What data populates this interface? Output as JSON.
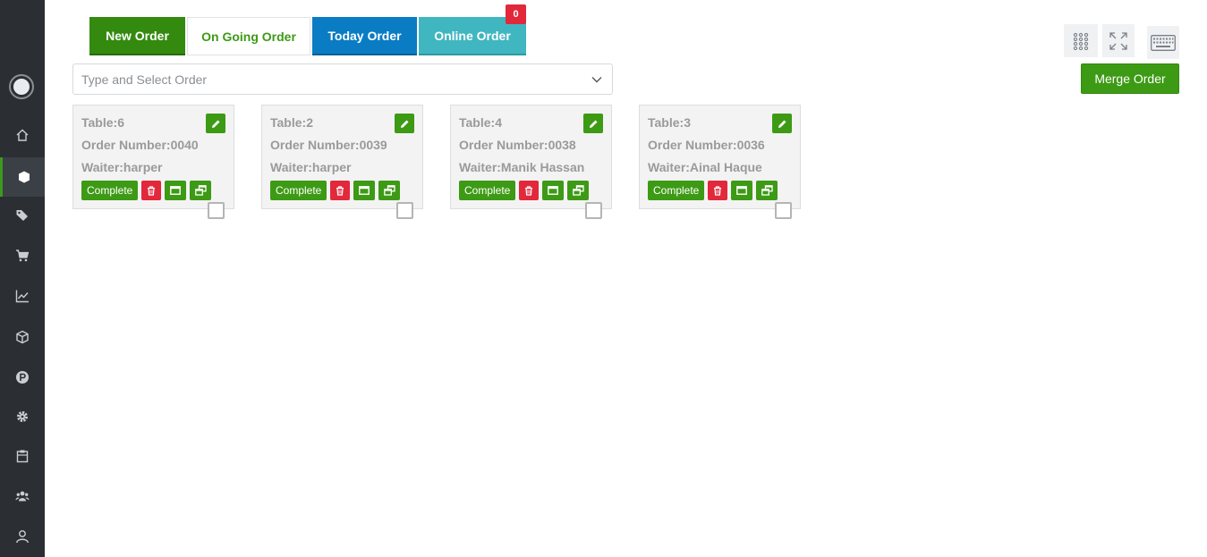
{
  "tabs": {
    "new_order": "New Order",
    "on_going_order": "On Going Order",
    "today_order": "Today Order",
    "online_order": "Online Order",
    "online_badge": "0"
  },
  "search": {
    "placeholder": "Type and Select Order"
  },
  "toolbar": {
    "merge_label": "Merge Order"
  },
  "sidebar": {
    "items": [
      {
        "icon": "home-icon"
      },
      {
        "icon": "cube-icon",
        "active": true
      },
      {
        "icon": "tags-icon"
      },
      {
        "icon": "cart-icon"
      },
      {
        "icon": "chart-line-icon"
      },
      {
        "icon": "box-icon"
      },
      {
        "icon": "parking-icon"
      },
      {
        "icon": "gear-icon"
      },
      {
        "icon": "clipboard-icon"
      },
      {
        "icon": "users-icon"
      },
      {
        "icon": "user-icon"
      }
    ]
  },
  "orders": [
    {
      "table": "Table:6",
      "order_number": "Order Number:0040",
      "waiter": "Waiter:harper",
      "complete_label": "Complete"
    },
    {
      "table": "Table:2",
      "order_number": "Order Number:0039",
      "waiter": "Waiter:harper",
      "complete_label": "Complete"
    },
    {
      "table": "Table:4",
      "order_number": "Order Number:0038",
      "waiter": "Waiter:Manik Hassan",
      "complete_label": "Complete"
    },
    {
      "table": "Table:3",
      "order_number": "Order Number:0036",
      "waiter": "Waiter:Ainal Haque",
      "complete_label": "Complete"
    }
  ],
  "colors": {
    "sidebar_bg": "#2b2f33",
    "green": "#3d9a15",
    "blue": "#0a7cc4",
    "teal": "#40b6c0",
    "red": "#e2283b"
  }
}
